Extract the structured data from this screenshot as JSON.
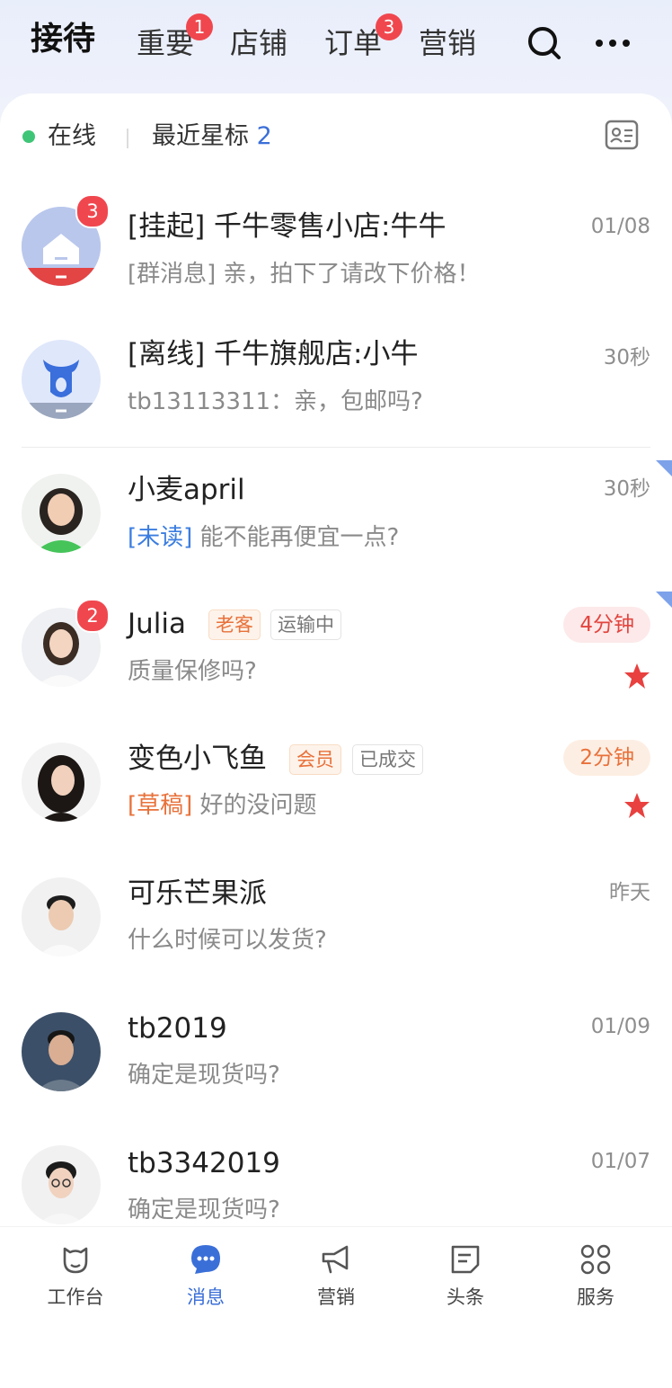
{
  "topnav": {
    "tabs": [
      {
        "label": "接待",
        "active": true,
        "badge": ""
      },
      {
        "label": "重要",
        "active": false,
        "badge": "1"
      },
      {
        "label": "店铺",
        "active": false,
        "badge": ""
      },
      {
        "label": "订单",
        "active": false,
        "badge": "3"
      },
      {
        "label": "营销",
        "active": false,
        "badge": ""
      }
    ],
    "search_icon": "search-icon",
    "more_icon": "more-dots-icon"
  },
  "status": {
    "online": "在线",
    "recent_star_label": "最近星标",
    "recent_star_count": "2",
    "contact_icon": "contact-card-icon"
  },
  "conversations": [
    {
      "name": "[挂起] 千牛零售小店:牛牛",
      "preview": "[群消息] 亲，拍下了请改下价格！",
      "time": "01/08",
      "badge": "3"
    },
    {
      "name": "[离线] 千牛旗舰店:小牛",
      "preview": "tb13113311：亲，包邮吗?",
      "time": "30秒",
      "badge": ""
    },
    {
      "name": "小麦april",
      "preview_prefix": "[未读]",
      "preview": " 能不能再便宜一点?",
      "time": "30秒",
      "badge": ""
    },
    {
      "name": "Julia",
      "tags": [
        "老客",
        "运输中"
      ],
      "preview": "质量保修吗?",
      "time": "4分钟",
      "badge": "2",
      "starred": true
    },
    {
      "name": "变色小飞鱼",
      "tags": [
        "会员",
        "已成交"
      ],
      "preview_prefix": "[草稿]",
      "preview": " 好的没问题",
      "time": "2分钟",
      "badge": "",
      "starred": true
    },
    {
      "name": "可乐芒果派",
      "preview": "什么时候可以发货?",
      "time": "昨天",
      "badge": ""
    },
    {
      "name": "tb2019",
      "preview": "确定是现货吗?",
      "time": "01/09",
      "badge": ""
    },
    {
      "name": "tb3342019",
      "preview": "确定是现货吗?",
      "time": "01/07",
      "badge": ""
    }
  ],
  "tabbar": [
    {
      "label": "工作台",
      "icon": "workbench-icon",
      "active": false
    },
    {
      "label": "消息",
      "icon": "message-icon",
      "active": true
    },
    {
      "label": "营销",
      "icon": "megaphone-icon",
      "active": false
    },
    {
      "label": "头条",
      "icon": "news-icon",
      "active": false
    },
    {
      "label": "服务",
      "icon": "grid-icon",
      "active": false
    }
  ],
  "colors": {
    "accent": "#3b6fd8",
    "badge": "#f0474f",
    "online": "#3fc577",
    "star": "#e8413f"
  }
}
